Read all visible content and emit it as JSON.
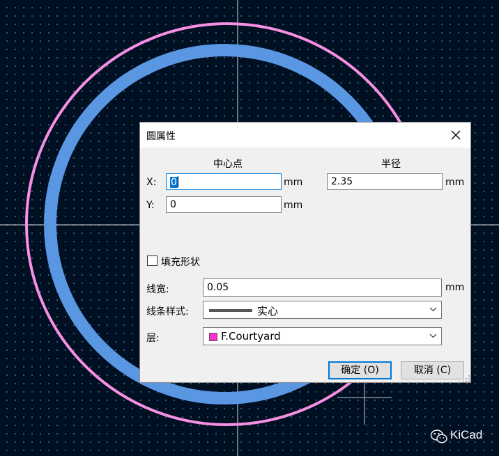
{
  "dialog": {
    "title": "圆属性",
    "center_header": "中心点",
    "radius_header": "半径",
    "x_label": "X:",
    "x_value": "0",
    "x_unit": "mm",
    "y_label": "Y:",
    "y_value": "0",
    "y_unit": "mm",
    "radius_value": "2.35",
    "radius_unit": "mm",
    "fill_label": "填充形状",
    "fill_checked": false,
    "linewidth_label": "线宽:",
    "linewidth_value": "0.05",
    "linewidth_unit": "mm",
    "linestyle_label": "线条样式:",
    "linestyle_value": "实心",
    "layer_label": "层:",
    "layer_value": "F.Courtyard",
    "layer_color": "#ff2fd2",
    "ok_label": "确定 (O)",
    "cancel_label": "取消 (C)"
  },
  "watermark": {
    "text": "KiCad",
    "icon": "wechat-icon"
  },
  "colors": {
    "canvas_background": "#001023",
    "courtyard_circle": "#f78fe2",
    "selected_circle": "#5a97e3",
    "crosshair": "#ffffff"
  }
}
